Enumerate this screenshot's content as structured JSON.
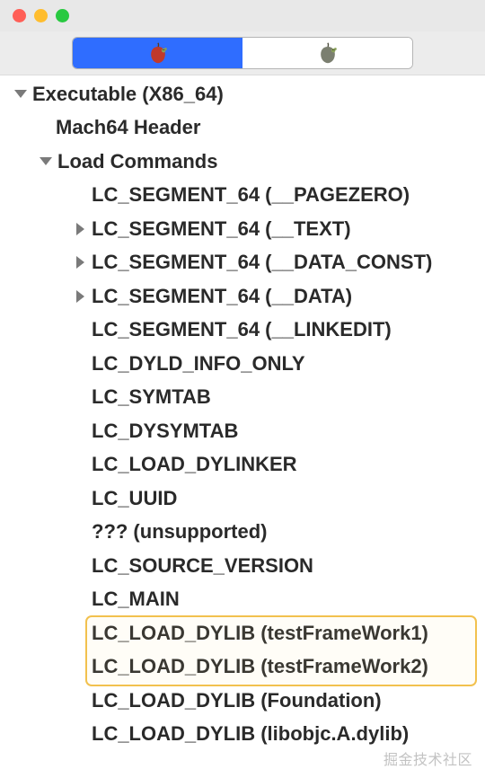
{
  "window": {
    "traffic_lights": {
      "close": "close",
      "minimize": "minimize",
      "maximize": "maximize"
    }
  },
  "toolbar": {
    "segment_active_icon": "red-apple-worm",
    "segment_inactive_icon": "gray-apple-worm"
  },
  "tree": {
    "root": {
      "label": "Executable  (X86_64)",
      "expanded": true
    },
    "header": {
      "label": "Mach64 Header"
    },
    "load_commands": {
      "label": "Load Commands",
      "expanded": true
    },
    "items": [
      {
        "label": "LC_SEGMENT_64 (__PAGEZERO)",
        "expandable": false
      },
      {
        "label": "LC_SEGMENT_64 (__TEXT)",
        "expandable": true
      },
      {
        "label": "LC_SEGMENT_64 (__DATA_CONST)",
        "expandable": true
      },
      {
        "label": "LC_SEGMENT_64 (__DATA)",
        "expandable": true
      },
      {
        "label": "LC_SEGMENT_64 (__LINKEDIT)",
        "expandable": false
      },
      {
        "label": "LC_DYLD_INFO_ONLY",
        "expandable": false
      },
      {
        "label": "LC_SYMTAB",
        "expandable": false
      },
      {
        "label": "LC_DYSYMTAB",
        "expandable": false
      },
      {
        "label": "LC_LOAD_DYLINKER",
        "expandable": false
      },
      {
        "label": "LC_UUID",
        "expandable": false
      },
      {
        "label": "??? (unsupported)",
        "expandable": false
      },
      {
        "label": "LC_SOURCE_VERSION",
        "expandable": false
      },
      {
        "label": "LC_MAIN",
        "expandable": false
      },
      {
        "label": "LC_LOAD_DYLIB (testFrameWork1)",
        "expandable": false,
        "highlighted": true
      },
      {
        "label": "LC_LOAD_DYLIB (testFrameWork2)",
        "expandable": false,
        "highlighted": true
      },
      {
        "label": "LC_LOAD_DYLIB (Foundation)",
        "expandable": false
      },
      {
        "label": "LC_LOAD_DYLIB (libobjc.A.dylib)",
        "expandable": false
      }
    ]
  },
  "watermark": "掘金技术社区"
}
